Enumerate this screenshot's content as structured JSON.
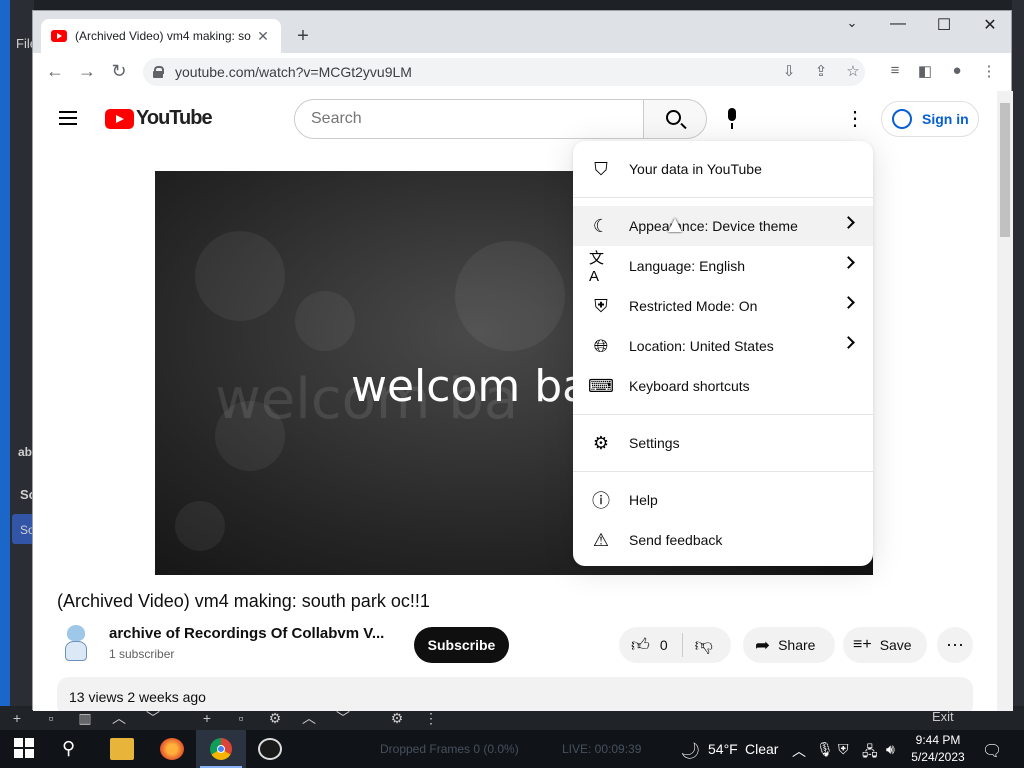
{
  "background_app": {
    "menu_label": "File",
    "side_labels": [
      "ab",
      "So",
      "So"
    ],
    "exit_label": "Exit",
    "status_dropped": "Dropped Frames 0 (0.0%)",
    "status_live": "LIVE: 00:09:39"
  },
  "browser": {
    "tab_title": "(Archived Video) vm4 making: so",
    "url": "youtube.com/watch?v=MCGt2yvu9LM"
  },
  "youtube": {
    "logo_text": "YouTube",
    "search_placeholder": "Search",
    "signin_label": "Sign in",
    "video_overlay_text": "welcom ba",
    "video_title": "(Archived Video) vm4 making: south park oc!!1",
    "channel_name": "archive of Recordings Of Collabvm V...",
    "subscriber_count": "1 subscriber",
    "subscribe_label": "Subscribe",
    "like_count": "0",
    "share_label": "Share",
    "save_label": "Save",
    "views_meta": "13 views  2 weeks ago"
  },
  "menu": {
    "your_data": "Your data in YouTube",
    "appearance": "Appearance: Device theme",
    "language": "Language: English",
    "restricted": "Restricted Mode: On",
    "location": "Location: United States",
    "keyboard": "Keyboard shortcuts",
    "settings": "Settings",
    "help": "Help",
    "feedback": "Send feedback"
  },
  "taskbar": {
    "weather_temp": "54°F",
    "weather_desc": "Clear",
    "time": "9:44 PM",
    "date": "5/24/2023"
  },
  "colors": {
    "youtube_red": "#ff0000",
    "link_blue": "#065fd4",
    "taskbar": "#101418"
  }
}
